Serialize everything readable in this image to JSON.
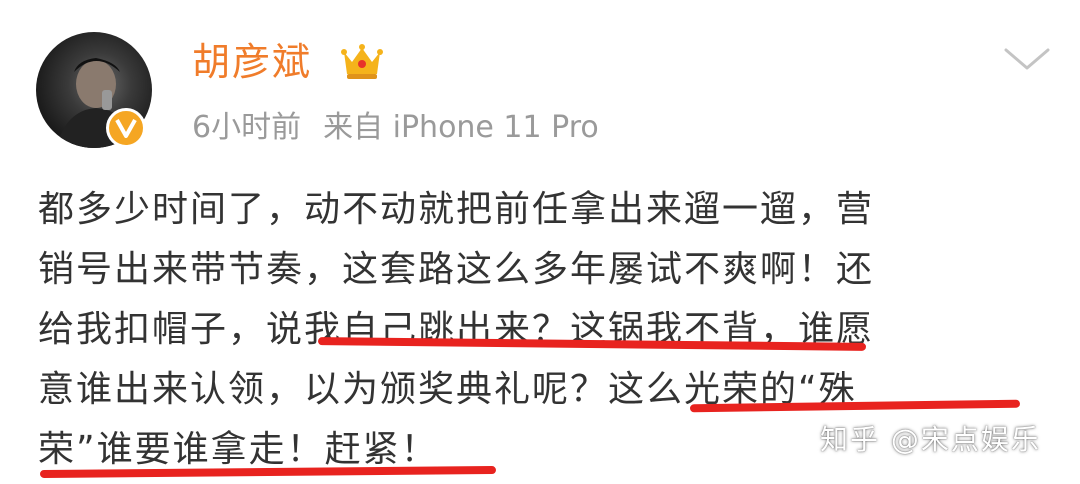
{
  "user": {
    "name": "胡彦斌",
    "time": "6小时前",
    "source": "来自 iPhone 11 Pro"
  },
  "post": {
    "lines": [
      "都多少时间了，动不动就把前任拿出来遛一遛，营",
      "销号出来带节奏，这套路这么多年屡试不爽啊！还",
      "给我扣帽子，说我自己跳出来？这锅我不背，谁愿",
      "意谁出来认领，以为颁奖典礼呢？这么光荣的“殊",
      "荣”谁要谁拿走！赶紧！"
    ]
  },
  "watermark": "知乎 @宋点娱乐",
  "colors": {
    "name": "#f07c2a",
    "badge": "#f5a623",
    "underline": "#e8231f"
  },
  "icons": [
    "crown-icon",
    "verified-v-icon",
    "chevron-down-icon"
  ]
}
